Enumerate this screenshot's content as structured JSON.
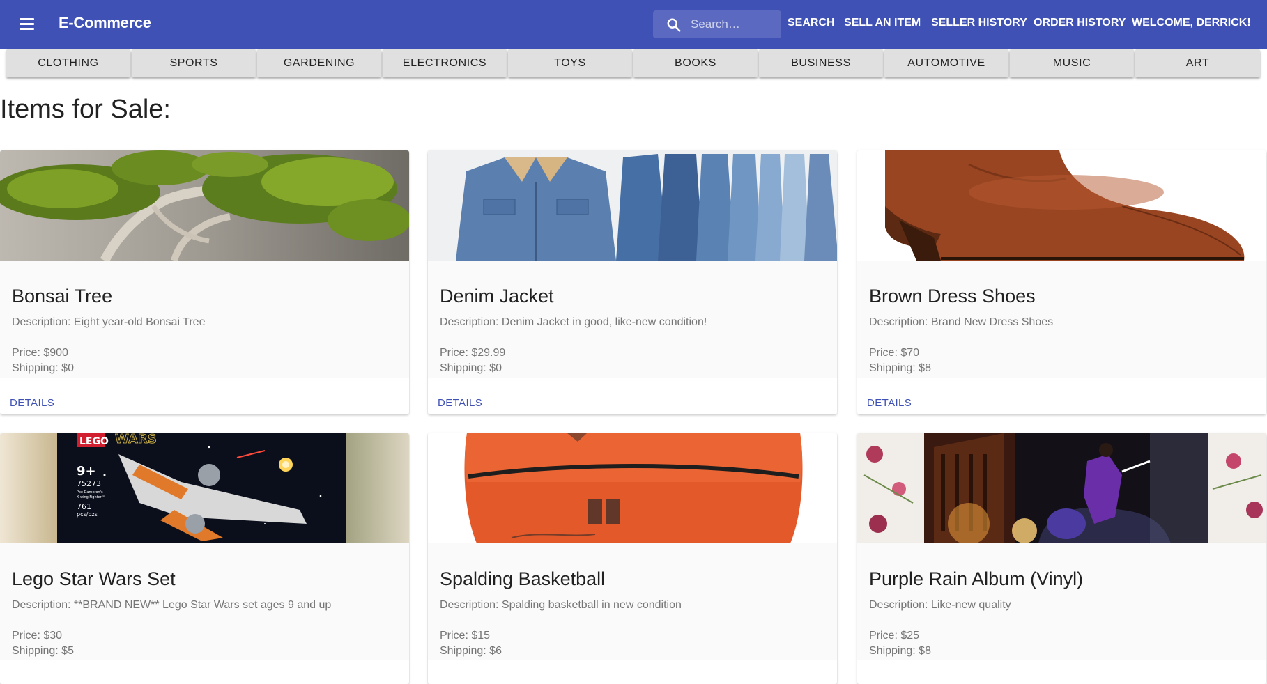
{
  "appbar": {
    "title": "E-Commerce",
    "search_placeholder": "Search…",
    "nav": {
      "search": "SEARCH",
      "sell": "SELL AN ITEM",
      "seller_history": "SELLER HISTORY",
      "order_history": "ORDER HISTORY",
      "welcome": "WELCOME, DERRICK!"
    }
  },
  "categories": [
    "CLOTHING",
    "SPORTS",
    "GARDENING",
    "ELECTRONICS",
    "TOYS",
    "BOOKS",
    "BUSINESS",
    "AUTOMOTIVE",
    "MUSIC",
    "ART"
  ],
  "main": {
    "heading": "Items for Sale:",
    "details_label": "DETAILS",
    "items": [
      {
        "name": "Bonsai Tree",
        "description": "Description: Eight year-old Bonsai Tree",
        "price": "Price: $900",
        "shipping": "Shipping: $0",
        "image": "bonsai-tree-photo"
      },
      {
        "name": "Denim Jacket",
        "description": "Description: Denim Jacket in good, like-new condition!",
        "price": "Price: $29.99",
        "shipping": "Shipping: $0",
        "image": "denim-jackets-photo"
      },
      {
        "name": "Brown Dress Shoes",
        "description": "Description: Brand New Dress Shoes",
        "price": "Price: $70",
        "shipping": "Shipping: $8",
        "image": "brown-shoe-photo"
      },
      {
        "name": "Lego Star Wars Set",
        "description": "Description: **BRAND NEW** Lego Star Wars set ages 9 and up",
        "price": "Price: $30",
        "shipping": "Shipping: $5",
        "image": "lego-box-photo",
        "image_text": {
          "brand": "LEGO",
          "theme": "WARS",
          "age": "9+",
          "set_number": "75273",
          "subtitle_1": "Poe Dameron's",
          "subtitle_2": "X-wing Fighter™",
          "pieces": "761",
          "pieces_label": "pcs/pzs"
        }
      },
      {
        "name": "Spalding Basketball",
        "description": "Description: Spalding basketball in new condition",
        "price": "Price: $15",
        "shipping": "Shipping: $6",
        "image": "basketball-photo"
      },
      {
        "name": "Purple Rain Album (Vinyl)",
        "description": "Description: Like-new quality",
        "price": "Price: $25",
        "shipping": "Shipping: $8",
        "image": "album-cover-photo"
      }
    ]
  },
  "colors": {
    "primary": "#3f51b5",
    "category_bg": "#e0e0e0",
    "card_content_bg": "#fafafa",
    "secondary_text": "#757575"
  }
}
